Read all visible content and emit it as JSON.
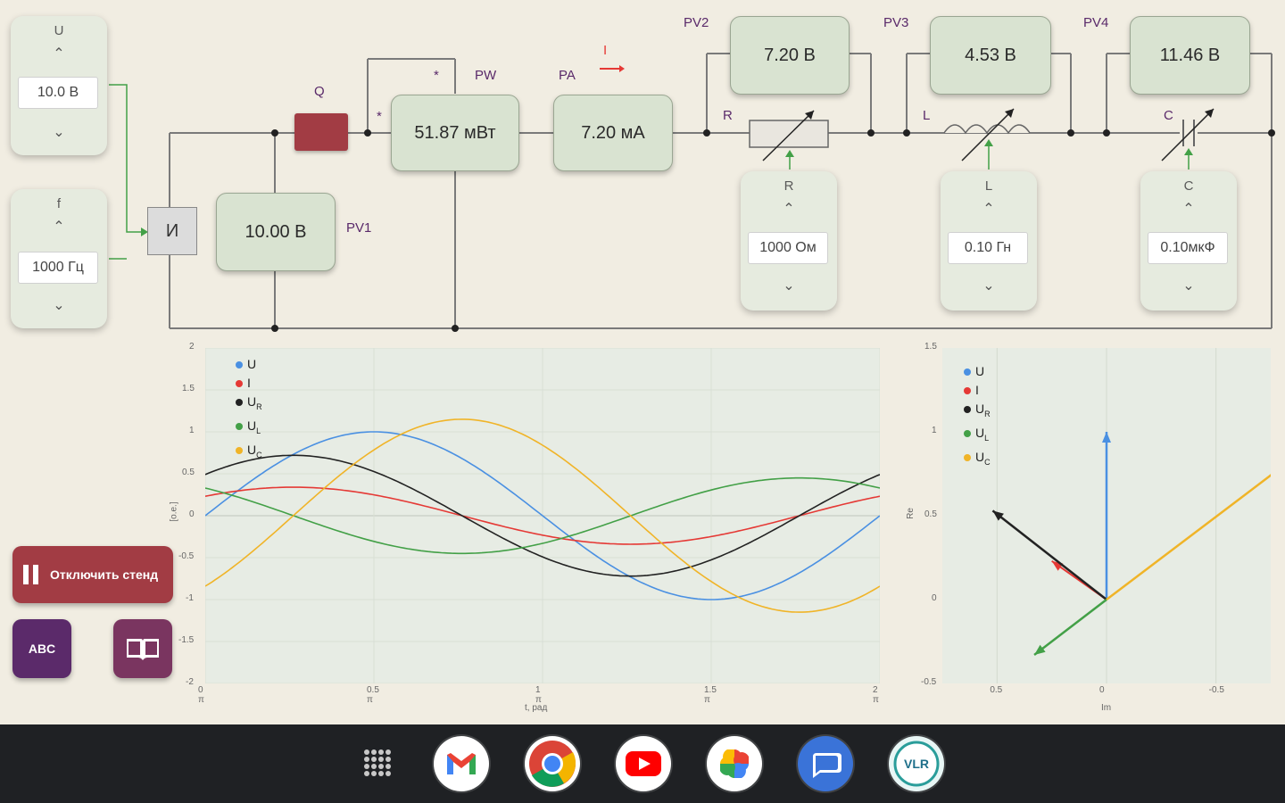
{
  "source": {
    "u_label": "U",
    "u_value": "10.0  В",
    "f_label": "f",
    "f_value": "1000 Гц",
    "up": "⌃",
    "down": "⌄",
    "gen_label": "И"
  },
  "circuit": {
    "q_label": "Q",
    "pw_label": "PW",
    "pw_star_top": "*",
    "pw_star_left": "*",
    "pa_label": "PA",
    "i_label": "I",
    "pv1_label": "PV1",
    "pv2_label": "PV2",
    "pv3_label": "PV3",
    "pv4_label": "PV4",
    "r_label": "R",
    "l_label": "L",
    "c_label": "C"
  },
  "meters": {
    "pw": "51.87 мВт",
    "pa": "7.20 мА",
    "pv1": "10.00 В",
    "pv2": "7.20 В",
    "pv3": "4.53 В",
    "pv4": "11.46 В"
  },
  "controls": {
    "r": {
      "name": "R",
      "value": "1000 Ом"
    },
    "l": {
      "name": "L",
      "value": "0.10  Гн"
    },
    "c": {
      "name": "C",
      "value": "0.10мкФ"
    }
  },
  "buttons": {
    "disconnect": "Отключить стенд",
    "abc": "ABC"
  },
  "colors": {
    "U": "#4a90e2",
    "I": "#e53935",
    "UR": "#222222",
    "UL": "#43a047",
    "UC": "#f0b428"
  },
  "wave_chart": {
    "legend": [
      "U",
      "I",
      "U",
      "U",
      "U"
    ],
    "legend_sub": [
      "",
      "",
      "R",
      "L",
      "C"
    ],
    "y_ticks": [
      "2",
      "1.5",
      "1",
      "0.5",
      "0",
      "-0.5",
      "-1",
      "-1.5",
      "-2"
    ],
    "x_ticks": [
      "0 π",
      "0.5 π",
      "1 π",
      "1.5 π",
      "2 π"
    ],
    "xlabel": "t, рад",
    "ylabel": "[о.е.]"
  },
  "phasor_chart": {
    "legend": [
      "U",
      "I",
      "U",
      "U",
      "U"
    ],
    "legend_sub": [
      "",
      "",
      "R",
      "L",
      "C"
    ],
    "y_ticks": [
      "1.5",
      "1",
      "0.5",
      "0",
      "-0.5"
    ],
    "x_ticks": [
      "0.5",
      "0",
      "-0.5"
    ],
    "xlabel": "Im",
    "ylabel": "Re"
  },
  "chart_data": [
    {
      "type": "line",
      "xlabel": "t, рад",
      "ylabel": "[о.е.]",
      "xlim": [
        0,
        6.2832
      ],
      "ylim": [
        -2,
        2
      ],
      "series": [
        {
          "name": "U",
          "amp": 1.0,
          "phase": 0
        },
        {
          "name": "I",
          "amp": 0.34,
          "phase": 0.75
        },
        {
          "name": "UR",
          "amp": 0.72,
          "phase": 0.75
        },
        {
          "name": "UL",
          "amp": 0.45,
          "phase": 2.32
        },
        {
          "name": "UC",
          "amp": 1.15,
          "phase": -0.82
        }
      ]
    },
    {
      "type": "scatter",
      "xlabel": "Im",
      "ylabel": "Re",
      "xlim": [
        0.75,
        -0.75
      ],
      "ylim": [
        -0.5,
        1.5
      ],
      "series": [
        {
          "name": "U",
          "x": 0,
          "y": 1.0
        },
        {
          "name": "I",
          "x": 0.25,
          "y": 0.23
        },
        {
          "name": "UR",
          "x": 0.52,
          "y": 0.53
        },
        {
          "name": "UL",
          "x": 0.33,
          "y": -0.33
        },
        {
          "name": "UC",
          "x": -0.81,
          "y": 0.8
        }
      ]
    }
  ]
}
